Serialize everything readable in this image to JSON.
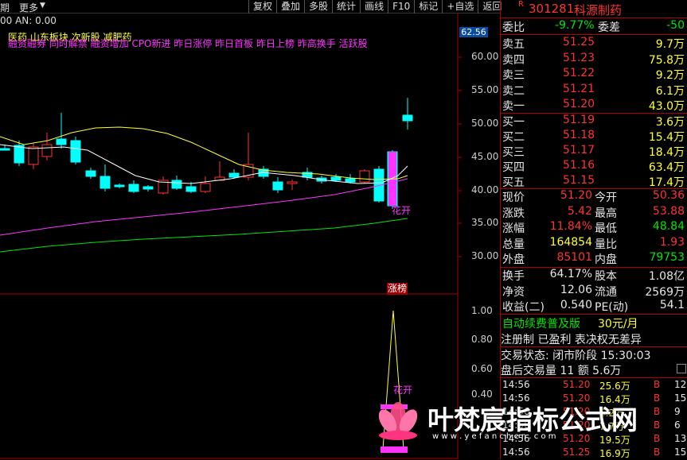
{
  "topbar": {
    "left1": "期",
    "left2": "更多",
    "menu": [
      "复权",
      "叠加",
      "多股",
      "统计",
      "画线",
      "F10",
      "标记",
      "+自选",
      "返回"
    ]
  },
  "indicator_label": "00  AN: 0.00",
  "tags_line1": "医药    山东板块   次新股  减肥药",
  "tags_line2": "融资融券 同时解禁 融资增加 CPO新进 昨日涨停 昨日首板 昨日上榜 昨高换手 活跃股",
  "price_badge": "62.56",
  "price_axis": [
    "60.00",
    "55.00",
    "50.00",
    "45.00",
    "40.00",
    "35.00",
    "30.00"
  ],
  "vol_axis": [
    "1.00",
    "0.80",
    "0.60",
    "0.40"
  ],
  "chart_labels": {
    "huakai1": "花开",
    "zhangbang": "涨榜",
    "huakai2": "花开"
  },
  "header": {
    "code": "301281",
    "name": "科源制药"
  },
  "weibi": {
    "label": "委比",
    "value": "-9.77%",
    "label2": "委差",
    "value2": "-50"
  },
  "asks": [
    {
      "label": "卖五",
      "price": "51.25",
      "vol": "9.7万"
    },
    {
      "label": "卖四",
      "price": "51.23",
      "vol": "75.8万"
    },
    {
      "label": "卖三",
      "price": "51.22",
      "vol": "9.2万"
    },
    {
      "label": "卖二",
      "price": "51.21",
      "vol": "6.1万"
    },
    {
      "label": "卖一",
      "price": "51.20",
      "vol": "43.0万"
    }
  ],
  "bids": [
    {
      "label": "买一",
      "price": "51.19",
      "vol": "3.6万"
    },
    {
      "label": "买二",
      "price": "51.18",
      "vol": "15.4万"
    },
    {
      "label": "买三",
      "price": "51.17",
      "vol": "18.4万"
    },
    {
      "label": "买四",
      "price": "51.16",
      "vol": "63.4万"
    },
    {
      "label": "买五",
      "price": "51.15",
      "vol": "17.4万"
    }
  ],
  "quote": [
    {
      "l1": "现价",
      "v1": "51.20",
      "l2": "今开",
      "v2": "50.36"
    },
    {
      "l1": "涨跌",
      "v1": "5.42",
      "l2": "最高",
      "v2": "53.88"
    },
    {
      "l1": "涨幅",
      "v1": "11.84%",
      "l2": "最低",
      "v2": "48.84"
    },
    {
      "l1": "总量",
      "v1": "164854",
      "l2": "量比",
      "v2": "1.93"
    },
    {
      "l1": "外盘",
      "v1": "85101",
      "l2": "内盘",
      "v2": "79753"
    }
  ],
  "fund": [
    {
      "l1": "换手",
      "v1": "64.17%",
      "l2": "股本",
      "v2": "1.08亿"
    },
    {
      "l1": "净资",
      "v1": "12.06",
      "l2": "流通",
      "v2": "2569万"
    },
    {
      "l1": "收益(二)",
      "v1": "0.540",
      "l2": "PE(动)",
      "v2": "54.1"
    }
  ],
  "promo": {
    "text": "自动续费普及版",
    "price": "30元/月"
  },
  "notice": "注册制 已盈利 表决权无差异",
  "status": "交易状态: 闭市阶段 15:30:03",
  "after": "盘后交易量 11 额 5.6万",
  "trades": [
    {
      "t": "14:56",
      "p": "51.20",
      "v": "25.6万",
      "d": "B",
      "n": "12"
    },
    {
      "t": "14:56",
      "p": "51.20",
      "v": "16.4万",
      "d": "B",
      "n": "15"
    },
    {
      "t": "14:56",
      "p": "51.20",
      "v": "6.2万",
      "d": "B",
      "n": "9"
    },
    {
      "t": "14:56",
      "p": "51.20",
      "v": "7.7万",
      "d": "B",
      "n": "6"
    },
    {
      "t": "14:56",
      "p": "51.20",
      "v": "19.5万",
      "d": "B",
      "n": "13"
    },
    {
      "t": "14:56",
      "p": "51.25",
      "v": "16.9万",
      "d": "B",
      "n": "15"
    }
  ],
  "watermark": {
    "cn": "叶梵宸指标公式网",
    "url": "w w w . y e f a n c h e n . c o m"
  }
}
